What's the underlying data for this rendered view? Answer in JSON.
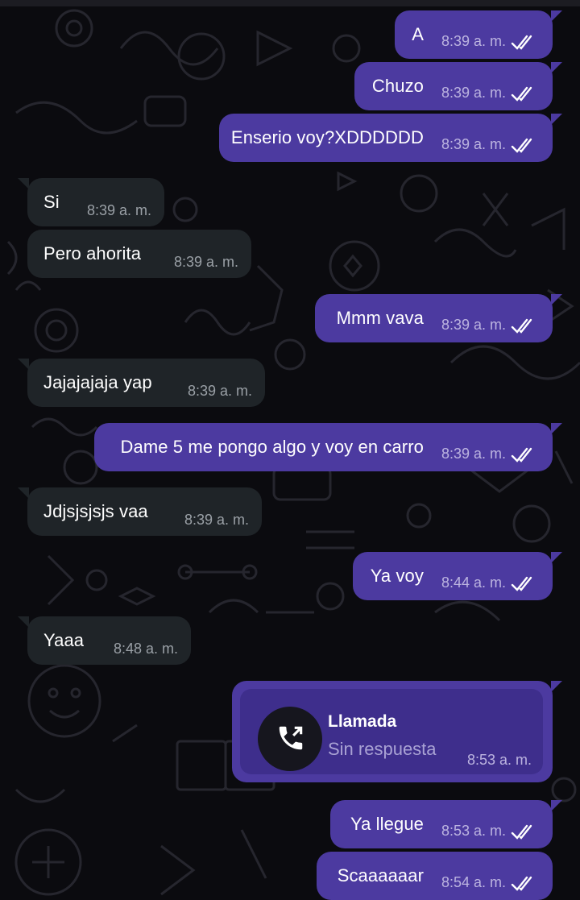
{
  "messages": [
    {
      "dir": "out",
      "text": "A",
      "time": "8:39 a. m.",
      "status": "double-check-icon"
    },
    {
      "dir": "out",
      "text": "Chuzo",
      "time": "8:39 a. m.",
      "status": "double-check-icon"
    },
    {
      "dir": "out",
      "text": "Enserio voy?XDDDDDD",
      "time": "8:39 a. m.",
      "status": "double-check-icon"
    },
    {
      "dir": "in",
      "text": "Si",
      "time": "8:39 a. m."
    },
    {
      "dir": "in",
      "text": "Pero ahorita",
      "time": "8:39 a. m."
    },
    {
      "dir": "out",
      "text": "Mmm vava",
      "time": "8:39 a. m.",
      "status": "double-check-icon"
    },
    {
      "dir": "in",
      "text": "Jajajajaja yap",
      "time": "8:39 a. m."
    },
    {
      "dir": "out",
      "text": "Dame 5 me pongo algo y voy en carro",
      "time": "8:39 a. m.",
      "status": "double-check-icon"
    },
    {
      "dir": "in",
      "text": "Jdjsjsjsjs vaa",
      "time": "8:39 a. m."
    },
    {
      "dir": "out",
      "text": "Ya voy",
      "time": "8:44 a. m.",
      "status": "double-check-icon"
    },
    {
      "dir": "in",
      "text": "Yaaa",
      "time": "8:48 a. m."
    },
    {
      "dir": "out",
      "text": "Ya llegue",
      "time": "8:53 a. m.",
      "status": "double-check-icon"
    },
    {
      "dir": "out",
      "text": "Scaaaaaar",
      "time": "8:54 a. m.",
      "status": "double-check-icon"
    }
  ],
  "call": {
    "title": "Llamada",
    "status": "Sin respuesta",
    "time": "8:53 a. m.",
    "icon": "outgoing-call-icon"
  },
  "colors": {
    "outgoing_bubble": "#4c3aa0",
    "incoming_bubble": "#1f2428",
    "background": "#0b0b0f",
    "read_ticks": "#ffffff"
  }
}
